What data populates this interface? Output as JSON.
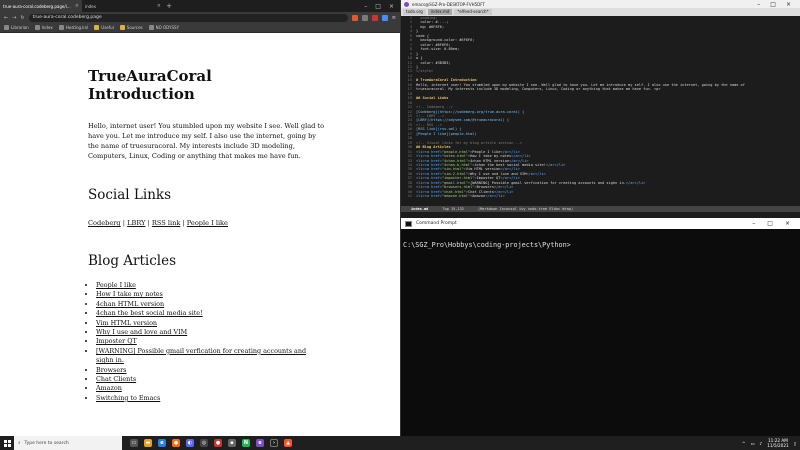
{
  "browser": {
    "tabs": [
      {
        "title": "true-aura-coral.codeberg.page/index.html",
        "active": true
      },
      {
        "title": "index",
        "active": false
      }
    ],
    "url": "true-aura-coral.codeberg.page",
    "bookmarks": [
      "Librarian",
      "Index",
      "Hosting.knl",
      "Useful",
      "Sources",
      "NO ODYSSY"
    ]
  },
  "page": {
    "title": "TrueAuraCoral Introduction",
    "intro": "Hello, internet user! You stumbled upon my website I see. Well glad to have you. Let me introduce my self. I also use the internet, going by the name of truesuracoral. My interests include 3D modeling, Computers, Linux, Coding or anything that makes me have fun.",
    "social_heading": "Social Links",
    "social_links": [
      "Codeberg",
      "LBRY",
      "RSS link",
      "People I like"
    ],
    "separator": "|",
    "blog_heading": "Blog Articles",
    "articles": [
      "People I like",
      "How I take my notes",
      "4chan HTML version",
      "4chan the best social media site!",
      "Vim HTML version",
      "Why I use and love and VIM",
      "Imposter QT",
      "[WARNING] Possible gmail verfication for creating accounts and sighn in.",
      "Browsers",
      "Chat Clients",
      "Amazon",
      "Switching to Emacs"
    ]
  },
  "emacs": {
    "title": "emacs@SGZ-Pro-DESKTOP-FVH5DFT",
    "tabs": [
      "todo.org",
      "index.md",
      "*elfeed-search*"
    ],
    "modeline": {
      "buffer": "index.md",
      "pos": "Top 15,132",
      "mode": "(Markdown Inconsol ivy undo-tree Eldoc Wrap)"
    }
  },
  "cmd": {
    "title": "Command Prompt",
    "prompt": "C:\\SGZ_Pro\\Hobbys\\coding-projects\\Python>"
  },
  "taskbar": {
    "search_placeholder": "Type here to search",
    "time": "11:22 AM",
    "date": "11/5/2021"
  }
}
